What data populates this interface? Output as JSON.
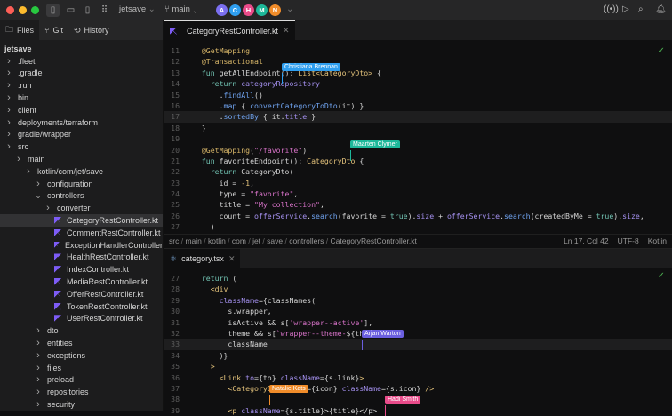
{
  "titlebar": {
    "project": "jetsave",
    "branch": "main",
    "avatars": [
      {
        "letter": "A",
        "color": "#7b6ff0"
      },
      {
        "letter": "C",
        "color": "#2f9ff0"
      },
      {
        "letter": "H",
        "color": "#e94b8a"
      },
      {
        "letter": "M",
        "color": "#1db89a"
      },
      {
        "letter": "N",
        "color": "#f08c2a"
      }
    ]
  },
  "panel_tabs": {
    "files": "Files",
    "git": "Git",
    "history": "History"
  },
  "tree": [
    {
      "label": "jetsave",
      "depth": 0,
      "kind": "root"
    },
    {
      "label": ".fleet",
      "depth": 1,
      "kind": "closed"
    },
    {
      "label": ".gradle",
      "depth": 1,
      "kind": "closed"
    },
    {
      "label": ".run",
      "depth": 1,
      "kind": "closed"
    },
    {
      "label": "bin",
      "depth": 1,
      "kind": "closed"
    },
    {
      "label": "client",
      "depth": 1,
      "kind": "closed"
    },
    {
      "label": "deployments/terraform",
      "depth": 1,
      "kind": "closed"
    },
    {
      "label": "gradle/wrapper",
      "depth": 1,
      "kind": "closed"
    },
    {
      "label": "src",
      "depth": 1,
      "kind": "closed"
    },
    {
      "label": "main",
      "depth": 2,
      "kind": "closed"
    },
    {
      "label": "kotlin/com/jet/save",
      "depth": 3,
      "kind": "closed"
    },
    {
      "label": "configuration",
      "depth": 4,
      "kind": "closed"
    },
    {
      "label": "controllers",
      "depth": 4,
      "kind": "open"
    },
    {
      "label": "converter",
      "depth": 5,
      "kind": "closed"
    },
    {
      "label": "CategoryRestController.kt",
      "depth": 5,
      "kind": "file",
      "selected": true
    },
    {
      "label": "CommentRestController.kt",
      "depth": 5,
      "kind": "file"
    },
    {
      "label": "ExceptionHandlerController",
      "depth": 5,
      "kind": "file"
    },
    {
      "label": "HealthRestController.kt",
      "depth": 5,
      "kind": "file"
    },
    {
      "label": "IndexController.kt",
      "depth": 5,
      "kind": "file"
    },
    {
      "label": "MediaRestController.kt",
      "depth": 5,
      "kind": "file"
    },
    {
      "label": "OfferRestController.kt",
      "depth": 5,
      "kind": "file"
    },
    {
      "label": "TokenRestController.kt",
      "depth": 5,
      "kind": "file"
    },
    {
      "label": "UserRestController.kt",
      "depth": 5,
      "kind": "file"
    },
    {
      "label": "dto",
      "depth": 4,
      "kind": "closed"
    },
    {
      "label": "entities",
      "depth": 4,
      "kind": "closed"
    },
    {
      "label": "exceptions",
      "depth": 4,
      "kind": "closed"
    },
    {
      "label": "files",
      "depth": 4,
      "kind": "closed"
    },
    {
      "label": "preload",
      "depth": 4,
      "kind": "closed"
    },
    {
      "label": "repositories",
      "depth": 4,
      "kind": "closed"
    },
    {
      "label": "security",
      "depth": 4,
      "kind": "closed"
    }
  ],
  "editor1": {
    "tab": "CategoryRestController.kt",
    "current_line": 17,
    "lines": [
      {
        "n": "11",
        "t": [
          [
            "p",
            "  "
          ],
          [
            "a",
            "@GetMapping"
          ]
        ]
      },
      {
        "n": "12",
        "t": [
          [
            "p",
            "  "
          ],
          [
            "a",
            "@Transactional"
          ]
        ]
      },
      {
        "n": "13",
        "t": [
          [
            "p",
            "  "
          ],
          [
            "k",
            "fun "
          ],
          [
            "p",
            "getAllEndpoint(): "
          ],
          [
            "t",
            "List<CategoryDto>"
          ],
          [
            "p",
            " {"
          ]
        ]
      },
      {
        "n": "14",
        "t": [
          [
            "p",
            "    "
          ],
          [
            "k",
            "return "
          ],
          [
            "v",
            "categoryRepository"
          ]
        ]
      },
      {
        "n": "15",
        "t": [
          [
            "p",
            "      ."
          ],
          [
            "f",
            "findAll"
          ],
          [
            "p",
            "()"
          ]
        ]
      },
      {
        "n": "16",
        "t": [
          [
            "p",
            "      ."
          ],
          [
            "f",
            "map"
          ],
          [
            "p",
            " { "
          ],
          [
            "f",
            "convertCategoryToDto"
          ],
          [
            "p",
            "(it) }"
          ]
        ]
      },
      {
        "n": "17",
        "t": [
          [
            "p",
            "      ."
          ],
          [
            "f",
            "sortedBy"
          ],
          [
            "p",
            " { it."
          ],
          [
            "v",
            "title"
          ],
          [
            "p",
            " }"
          ]
        ]
      },
      {
        "n": "18",
        "t": [
          [
            "p",
            "  }"
          ]
        ]
      },
      {
        "n": "19",
        "t": []
      },
      {
        "n": "20",
        "t": [
          [
            "p",
            "  "
          ],
          [
            "a",
            "@GetMapping"
          ],
          [
            "p",
            "("
          ],
          [
            "s",
            "\"/favorite\""
          ],
          [
            "p",
            ")"
          ]
        ]
      },
      {
        "n": "21",
        "t": [
          [
            "p",
            "  "
          ],
          [
            "k",
            "fun "
          ],
          [
            "p",
            "favoriteEndpoint(): "
          ],
          [
            "t",
            "CategoryDto"
          ],
          [
            "p",
            " {"
          ]
        ]
      },
      {
        "n": "22",
        "t": [
          [
            "p",
            "    "
          ],
          [
            "k",
            "return "
          ],
          [
            "p",
            "CategoryDto("
          ]
        ]
      },
      {
        "n": "23",
        "t": [
          [
            "p",
            "      id = "
          ],
          [
            "n",
            "-1"
          ],
          [
            "p",
            ","
          ]
        ]
      },
      {
        "n": "24",
        "t": [
          [
            "p",
            "      type = "
          ],
          [
            "s",
            "\"favorite\""
          ],
          [
            "p",
            ","
          ]
        ]
      },
      {
        "n": "25",
        "t": [
          [
            "p",
            "      title = "
          ],
          [
            "s",
            "\"My collection\""
          ],
          [
            "p",
            ","
          ]
        ]
      },
      {
        "n": "26",
        "t": [
          [
            "p",
            "      count = "
          ],
          [
            "v",
            "offerService"
          ],
          [
            "p",
            "."
          ],
          [
            "f",
            "search"
          ],
          [
            "p",
            "(favorite = "
          ],
          [
            "k",
            "true"
          ],
          [
            "p",
            ")."
          ],
          [
            "v",
            "size"
          ],
          [
            "p",
            " + "
          ],
          [
            "v",
            "offerService"
          ],
          [
            "p",
            "."
          ],
          [
            "f",
            "search"
          ],
          [
            "p",
            "(createdByMe = "
          ],
          [
            "k",
            "true"
          ],
          [
            "p",
            ")."
          ],
          [
            "v",
            "size"
          ],
          [
            "p",
            ","
          ]
        ]
      },
      {
        "n": "27",
        "t": [
          [
            "p",
            "    )"
          ]
        ]
      }
    ],
    "collaborators": [
      {
        "name": "Christiana Brennan",
        "color": "#2f9ff0"
      },
      {
        "name": "Maarten Clymer",
        "color": "#1db89a"
      }
    ],
    "breadcrumb": [
      "src",
      "main",
      "kotlin",
      "com",
      "jet",
      "save",
      "controllers",
      "CategoryRestController.kt"
    ],
    "status": {
      "position": "Ln 17, Col 42",
      "encoding": "UTF-8",
      "language": "Kotlin"
    }
  },
  "editor2": {
    "tab": "category.tsx",
    "current_line": 33,
    "lines": [
      {
        "n": "27",
        "t": [
          [
            "p",
            "  "
          ],
          [
            "k",
            "return"
          ],
          [
            "p",
            " ("
          ]
        ]
      },
      {
        "n": "28",
        "t": [
          [
            "p",
            "    "
          ],
          [
            "t",
            "<div"
          ]
        ]
      },
      {
        "n": "29",
        "t": [
          [
            "p",
            "      "
          ],
          [
            "v",
            "className"
          ],
          [
            "p",
            "={classNames("
          ]
        ]
      },
      {
        "n": "30",
        "t": [
          [
            "p",
            "        s.wrapper,"
          ]
        ]
      },
      {
        "n": "31",
        "t": [
          [
            "p",
            "        isActive && s["
          ],
          [
            "s",
            "'wrapper--active'"
          ],
          [
            "p",
            "],"
          ]
        ]
      },
      {
        "n": "32",
        "t": [
          [
            "p",
            "        theme && s["
          ],
          [
            "s",
            "`wrapper--theme-"
          ],
          [
            "p",
            "${theme}"
          ],
          [
            "s",
            "`"
          ],
          [
            "p",
            "],"
          ]
        ]
      },
      {
        "n": "33",
        "t": [
          [
            "p",
            "        className"
          ]
        ]
      },
      {
        "n": "34",
        "t": [
          [
            "p",
            "      )}"
          ]
        ]
      },
      {
        "n": "35",
        "t": [
          [
            "p",
            "    "
          ],
          [
            "t",
            ">"
          ]
        ]
      },
      {
        "n": "36",
        "t": [
          [
            "p",
            "      "
          ],
          [
            "t",
            "<Link "
          ],
          [
            "v",
            "to"
          ],
          [
            "p",
            "={to} "
          ],
          [
            "v",
            "className"
          ],
          [
            "p",
            "={s.link}"
          ],
          [
            "t",
            ">"
          ]
        ]
      },
      {
        "n": "37",
        "t": [
          [
            "p",
            "        "
          ],
          [
            "t",
            "<CategoryIcon "
          ],
          [
            "v",
            "type"
          ],
          [
            "p",
            "={icon} "
          ],
          [
            "v",
            "className"
          ],
          [
            "p",
            "={s.icon} "
          ],
          [
            "t",
            "/>"
          ]
        ]
      },
      {
        "n": "38",
        "t": []
      },
      {
        "n": "39",
        "t": [
          [
            "p",
            "        "
          ],
          [
            "t",
            "<p "
          ],
          [
            "v",
            "className"
          ],
          [
            "p",
            "={s.title}>{title}</p>"
          ]
        ]
      }
    ],
    "collaborators": [
      {
        "name": "Arjan Warton",
        "color": "#6b5fe0"
      },
      {
        "name": "Natalie Kats",
        "color": "#f08c2a"
      },
      {
        "name": "Hadi Smith",
        "color": "#e94b8a"
      }
    ]
  }
}
